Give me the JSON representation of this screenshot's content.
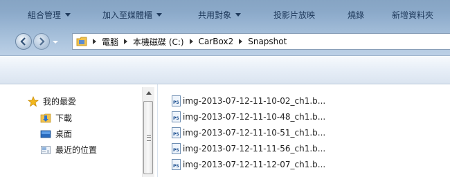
{
  "address_bar": {
    "breadcrumbs": [
      "電腦",
      "本機磁碟 (C:)",
      "CarBox2",
      "Snapshot"
    ]
  },
  "toolbar": {
    "organize": "組合管理",
    "add_to_library": "加入至媒體櫃",
    "share_with": "共用對象",
    "slideshow": "投影片放映",
    "burn": "燒錄",
    "new_folder": "新增資料夾"
  },
  "nav_pane": {
    "favorites": "我的最愛",
    "items": [
      "下載",
      "桌面",
      "最近的位置"
    ]
  },
  "files": [
    "img-2013-07-12-11-10-02_ch1.b...",
    "img-2013-07-12-11-10-48_ch1.b...",
    "img-2013-07-12-11-10-51_ch1.b...",
    "img-2013-07-12-11-11-56_ch1.b...",
    "img-2013-07-12-11-12-07_ch1.b..."
  ],
  "file_icon_text": "PS",
  "colors": {
    "title_gradient_top": "#7f9fc0",
    "command_text": "#1e395b",
    "favorites_star": "#f3b81c"
  }
}
